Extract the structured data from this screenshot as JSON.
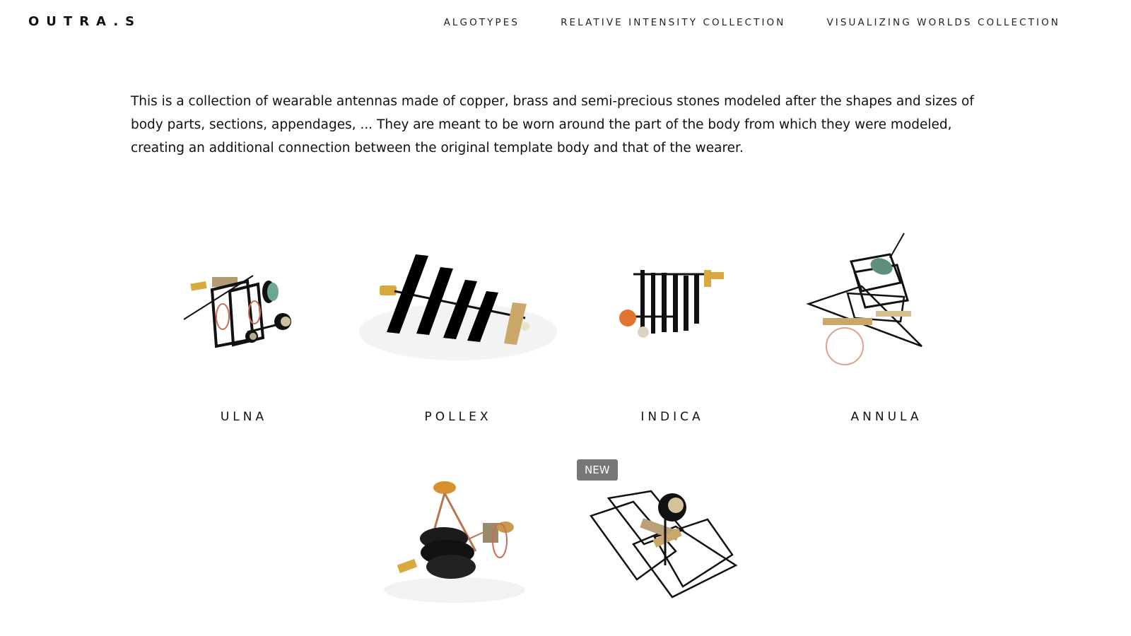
{
  "header": {
    "brand": "OUTRA.S",
    "nav": [
      {
        "label": "ALGOTYPES"
      },
      {
        "label": "RELATIVE INTENSITY COLLECTION"
      },
      {
        "label": "VISUALIZING WORLDS COLLECTION"
      }
    ]
  },
  "intro": {
    "text": "This is a collection of wearable antennas made of copper, brass and semi-precious stones modeled after the shapes and sizes of body parts, sections, appendages, ... They are meant to be worn around the part of the body from which they were modeled, creating an additional connection between the original template body and that of the wearer."
  },
  "gallery": {
    "items": [
      {
        "title": "ULNA"
      },
      {
        "title": "POLLEX"
      },
      {
        "title": "INDICA"
      },
      {
        "title": "ANNULA"
      },
      {
        "title": ""
      },
      {
        "title": "",
        "badge": "NEW"
      }
    ]
  }
}
